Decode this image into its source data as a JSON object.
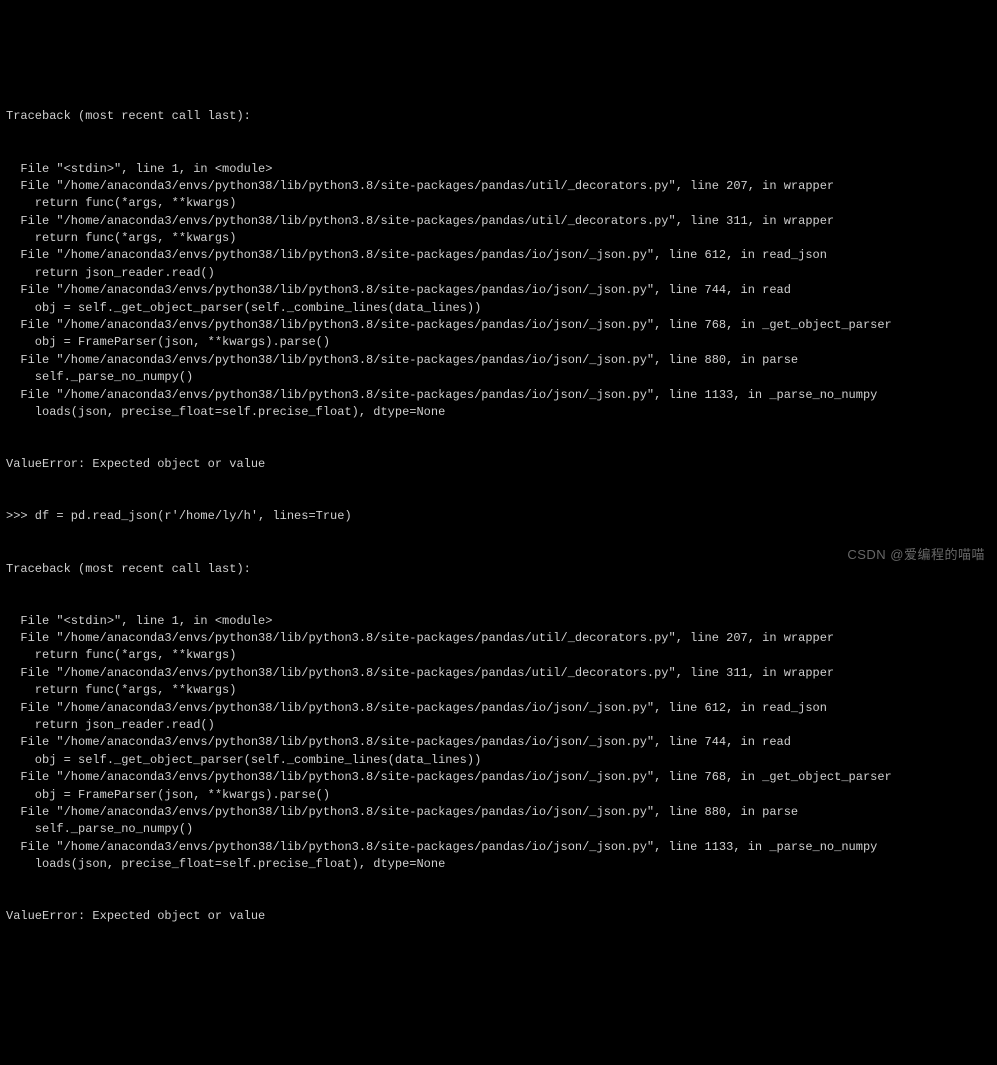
{
  "traceback1": {
    "header": "Traceback (most recent call last):",
    "frames": [
      {
        "file": "  File \"<stdin>\", line 1, in <module>",
        "code": null
      },
      {
        "file": "  File \"/home/anaconda3/envs/python38/lib/python3.8/site-packages/pandas/util/_decorators.py\", line 207, in wrapper",
        "code": "    return func(*args, **kwargs)"
      },
      {
        "file": "  File \"/home/anaconda3/envs/python38/lib/python3.8/site-packages/pandas/util/_decorators.py\", line 311, in wrapper",
        "code": "    return func(*args, **kwargs)"
      },
      {
        "file": "  File \"/home/anaconda3/envs/python38/lib/python3.8/site-packages/pandas/io/json/_json.py\", line 612, in read_json",
        "code": "    return json_reader.read()"
      },
      {
        "file": "  File \"/home/anaconda3/envs/python38/lib/python3.8/site-packages/pandas/io/json/_json.py\", line 744, in read",
        "code": "    obj = self._get_object_parser(self._combine_lines(data_lines))"
      },
      {
        "file": "  File \"/home/anaconda3/envs/python38/lib/python3.8/site-packages/pandas/io/json/_json.py\", line 768, in _get_object_parser",
        "code": "    obj = FrameParser(json, **kwargs).parse()"
      },
      {
        "file": "  File \"/home/anaconda3/envs/python38/lib/python3.8/site-packages/pandas/io/json/_json.py\", line 880, in parse",
        "code": "    self._parse_no_numpy()"
      },
      {
        "file": "  File \"/home/anaconda3/envs/python38/lib/python3.8/site-packages/pandas/io/json/_json.py\", line 1133, in _parse_no_numpy",
        "code": "    loads(json, precise_float=self.precise_float), dtype=None"
      }
    ],
    "error": "ValueError: Expected object or value"
  },
  "prompt_line": ">>> df = pd.read_json(r'/home/ly/h', lines=True)",
  "traceback2": {
    "header": "Traceback (most recent call last):",
    "frames": [
      {
        "file": "  File \"<stdin>\", line 1, in <module>",
        "code": null
      },
      {
        "file": "  File \"/home/anaconda3/envs/python38/lib/python3.8/site-packages/pandas/util/_decorators.py\", line 207, in wrapper",
        "code": "    return func(*args, **kwargs)"
      },
      {
        "file": "  File \"/home/anaconda3/envs/python38/lib/python3.8/site-packages/pandas/util/_decorators.py\", line 311, in wrapper",
        "code": "    return func(*args, **kwargs)"
      },
      {
        "file": "  File \"/home/anaconda3/envs/python38/lib/python3.8/site-packages/pandas/io/json/_json.py\", line 612, in read_json",
        "code": "    return json_reader.read()"
      },
      {
        "file": "  File \"/home/anaconda3/envs/python38/lib/python3.8/site-packages/pandas/io/json/_json.py\", line 744, in read",
        "code": "    obj = self._get_object_parser(self._combine_lines(data_lines))"
      },
      {
        "file": "  File \"/home/anaconda3/envs/python38/lib/python3.8/site-packages/pandas/io/json/_json.py\", line 768, in _get_object_parser",
        "code": "    obj = FrameParser(json, **kwargs).parse()"
      },
      {
        "file": "  File \"/home/anaconda3/envs/python38/lib/python3.8/site-packages/pandas/io/json/_json.py\", line 880, in parse",
        "code": "    self._parse_no_numpy()"
      },
      {
        "file": "  File \"/home/anaconda3/envs/python38/lib/python3.8/site-packages/pandas/io/json/_json.py\", line 1133, in _parse_no_numpy",
        "code": "    loads(json, precise_float=self.precise_float), dtype=None"
      }
    ],
    "error": "ValueError: Expected object or value"
  },
  "watermark": "CSDN @爱编程的喵喵"
}
